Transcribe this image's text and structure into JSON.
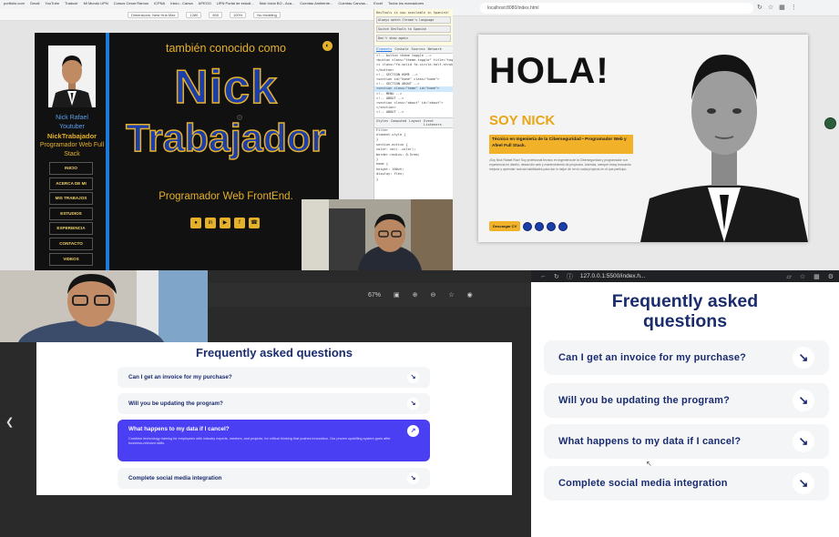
{
  "q1": {
    "bookmarks": [
      "portfolio.com",
      "Gmail",
      "YouTube",
      "Traducir",
      "Mi Mundo UPN",
      "Cursos Cesar Ramos",
      "ICPNA",
      "Inicio - Canva",
      "APEGO",
      "UPN Portal de estudi...",
      "Nick Inicio BO - Aca...",
      "Cuentas Ambiente...",
      "Cuentas Canvas...",
      "Excel",
      "Todos los marcadores"
    ],
    "device_toolbar": [
      "Dimensions: Nest Hub Max",
      "1280",
      "800",
      "100%",
      "No throttling"
    ],
    "site": {
      "name_line1": "Nick Rafael",
      "name_line2": "Youtuber",
      "handle": "NickTrabajador",
      "role_short": "Programador Web Full Stack",
      "menu": [
        "INICIO",
        "ACERCA DE MI",
        "MIS TRABAJOS",
        "ESTUDIOS",
        "EXPERIENCIA",
        "CONTACTO",
        "VIDEOS"
      ],
      "tambien": "también conocido como",
      "big_line1": "Nick",
      "big_line2": "Trabajador",
      "role": "Programador Web FrontEnd.",
      "socials": [
        "github-icon",
        "linkedin-icon",
        "youtube-icon",
        "facebook-icon",
        "whatsapp-icon"
      ]
    },
    "devtools": {
      "notice_title": "DevTools is now available in Spanish!",
      "notice_buttons": [
        "Always match Chrome's language",
        "Switch DevTools to Spanish",
        "Don't show again"
      ],
      "tabs": [
        "Elements",
        "Console",
        "Sources",
        "Network"
      ],
      "code_lines": [
        "<!-- button theme toggle -->",
        "<button class=\"theme-toggle\" title=\"toggle-theme\">",
        "<i class=\"fa-solid fa-circle-half-stroke\"></i>",
        "</button>",
        "<!-- SECTION HOME -->",
        "<section id=\"home\" class=\"home\">",
        "<!-- SECTION ABOUT -->",
        "<section class=\"home\" id=\"home\">",
        "<!-- MENU -->",
        "<!-- ABOUT -->",
        "<section class=\"about\" id=\"about\">",
        "</section>",
        "<!-- ABOUT -->"
      ],
      "selected_line": "<section class=\"home\" id=\"home\">",
      "style_tabs": [
        "Styles",
        "Computed",
        "Layout",
        "Event Listeners"
      ],
      "style_lines": [
        "Filter",
        "element.style {",
        "}",
        "section.active {",
        "  color: var(--color);",
        "  border-radius: 0.5rem;",
        "}",
        "home {",
        "  height: 100vh;",
        "  display: flex;",
        "}"
      ]
    }
  },
  "q2": {
    "url": "localhost:8080/index.html",
    "hola": "HOLA!",
    "soy": "SOY NICK",
    "badge": "Técnico en Ingeniería de la Ciberseguridad • Programador Web y Afeel Full Stack.",
    "para": "¡Soy Nick Rafael Ruiz! Soy profesional técnico en ingeniería de la Ciberseguridad y programador con experiencia en diseño, desarrollo web y mantenimiento de proyectos. Además, siempre estoy buscando mejorar y aprender nuevas habilidades para dar lo mejor de mí en cada proyecto en el que participo.",
    "cta": "Descargar CV"
  },
  "q3": {
    "faq_title": "Frequently asked questions",
    "items": [
      {
        "q": "Can I get an invoice for my purchase?"
      },
      {
        "q": "Will you be updating the program?"
      },
      {
        "q": "What happens to my data if I cancel?",
        "desc": "Combine technology training for employees with industry experts, mentors, and projects, for critical thinking that pushes innovation. Our proven upskilling system goes after business-relevant skills."
      },
      {
        "q": "Complete social media integration"
      }
    ],
    "zoom": "67%"
  },
  "q4": {
    "url": "127.0.0.1:5500/index.h...",
    "title_line1": "Frequently asked",
    "title_line2": "questions",
    "items": [
      "Can I get an invoice for my purchase?",
      "Will you be updating the program?",
      "What happens to my data if I cancel?",
      "Complete social media integration"
    ]
  },
  "colors": {
    "site_gold": "#e6b12a",
    "site_blue": "#1c3ea8",
    "faq_navy": "#1a2c6e",
    "faq_open": "#4a3ff3"
  }
}
